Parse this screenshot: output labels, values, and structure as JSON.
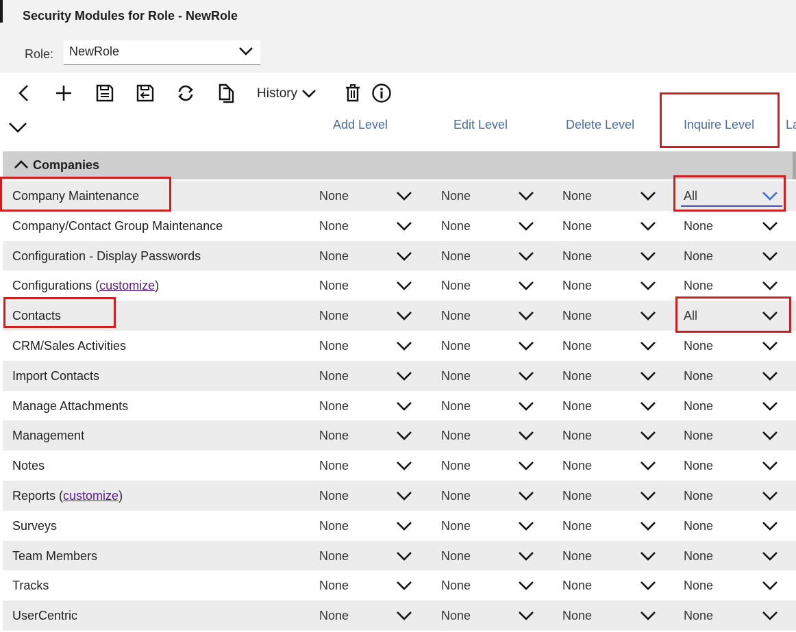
{
  "header": {
    "title": "Security Modules for Role - NewRole"
  },
  "role": {
    "label": "Role:",
    "value": "NewRole"
  },
  "toolbar": {
    "history_label": "History",
    "icons": [
      "back-icon",
      "add-icon",
      "save-icon",
      "save-close-icon",
      "refresh-icon",
      "copy-icon",
      "chevron-down-icon",
      "trash-icon",
      "info-icon"
    ]
  },
  "columns": {
    "add": "Add Level",
    "edit": "Edit Level",
    "delete": "Delete Level",
    "inquire": "Inquire Level",
    "next_partial": "La"
  },
  "group": {
    "label": "Companies",
    "expanded": true
  },
  "rows": [
    {
      "name": "Company Maintenance",
      "add": "None",
      "edit": "None",
      "delete": "None",
      "inquire": "All"
    },
    {
      "name": "Company/Contact Group Maintenance",
      "add": "None",
      "edit": "None",
      "delete": "None",
      "inquire": "None"
    },
    {
      "name": "Configuration - Display Passwords",
      "add": "None",
      "edit": "None",
      "delete": "None",
      "inquire": "None"
    },
    {
      "name": "Configurations",
      "link": "customize",
      "add": "None",
      "edit": "None",
      "delete": "None",
      "inquire": "None"
    },
    {
      "name": "Contacts",
      "add": "None",
      "edit": "None",
      "delete": "None",
      "inquire": "All"
    },
    {
      "name": "CRM/Sales Activities",
      "add": "None",
      "edit": "None",
      "delete": "None",
      "inquire": "None"
    },
    {
      "name": "Import Contacts",
      "add": "None",
      "edit": "None",
      "delete": "None",
      "inquire": "None"
    },
    {
      "name": "Manage Attachments",
      "add": "None",
      "edit": "None",
      "delete": "None",
      "inquire": "None"
    },
    {
      "name": "Management",
      "add": "None",
      "edit": "None",
      "delete": "None",
      "inquire": "None"
    },
    {
      "name": "Notes",
      "add": "None",
      "edit": "None",
      "delete": "None",
      "inquire": "None"
    },
    {
      "name": "Reports",
      "link": "customize",
      "add": "None",
      "edit": "None",
      "delete": "None",
      "inquire": "None"
    },
    {
      "name": "Surveys",
      "add": "None",
      "edit": "None",
      "delete": "None",
      "inquire": "None"
    },
    {
      "name": "Team Members",
      "add": "None",
      "edit": "None",
      "delete": "None",
      "inquire": "None"
    },
    {
      "name": "Tracks",
      "add": "None",
      "edit": "None",
      "delete": "None",
      "inquire": "None"
    },
    {
      "name": "UserCentric",
      "add": "None",
      "edit": "None",
      "delete": "None",
      "inquire": "None"
    }
  ],
  "colors": {
    "highlight": "#cc1f1f",
    "header_text": "#4a6a9a",
    "link": "#5a1a8a",
    "focus_underline": "#4a50a8"
  }
}
